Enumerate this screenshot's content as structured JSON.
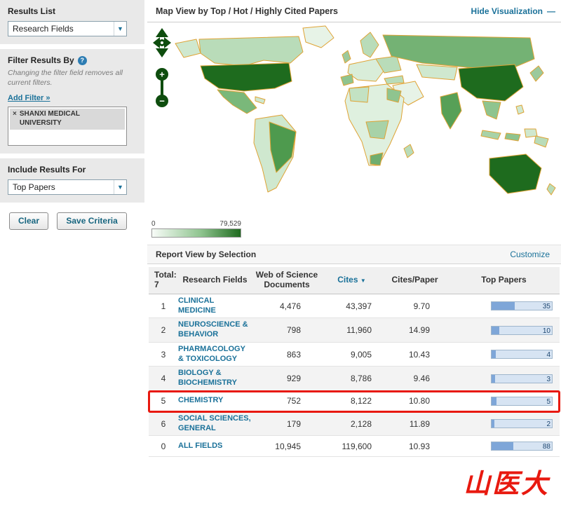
{
  "icons": {
    "dropdown_arrow": "▼",
    "sort_desc": "▼",
    "help": "?",
    "minimize": "—",
    "remove": "×",
    "zoom_in": "+",
    "zoom_out": "−"
  },
  "sidebar": {
    "results_list": {
      "label": "Results List",
      "dropdown_value": "Research Fields"
    },
    "filter": {
      "label": "Filter Results By",
      "note": "Changing the filter field removes all current filters.",
      "add_filter_label": "Add Filter »",
      "selected_filter": "SHANXI MEDICAL UNIVERSITY"
    },
    "include": {
      "label": "Include Results For",
      "dropdown_value": "Top Papers"
    },
    "buttons": {
      "clear": "Clear",
      "save": "Save Criteria"
    }
  },
  "header": {
    "title": "Map View by  Top / Hot / Highly Cited Papers",
    "hide_link": "Hide Visualization"
  },
  "map": {
    "legend_min": "0",
    "legend_max": "79,529",
    "min_color": "#f8fcf8",
    "max_color": "#1f6b1f",
    "border_color": "#dfa335"
  },
  "report": {
    "title": "Report View by Selection",
    "customize": "Customize"
  },
  "table": {
    "total_label": "Total:",
    "total_value": "7",
    "columns": {
      "field": "Research Fields",
      "docs": "Web of Science Documents",
      "cites": "Cites",
      "cpp": "Cites/Paper",
      "top": "Top Papers"
    },
    "rows": [
      {
        "rank": "1",
        "field": "CLINICAL MEDICINE",
        "docs": "4,476",
        "cites": "43,397",
        "cpp": "9.70",
        "top": "35",
        "bar_pct": 38,
        "highlight": false
      },
      {
        "rank": "2",
        "field": "NEUROSCIENCE & BEHAVIOR",
        "docs": "798",
        "cites": "11,960",
        "cpp": "14.99",
        "top": "10",
        "bar_pct": 13,
        "highlight": false
      },
      {
        "rank": "3",
        "field": "PHARMACOLOGY & TOXICOLOGY",
        "docs": "863",
        "cites": "9,005",
        "cpp": "10.43",
        "top": "4",
        "bar_pct": 7,
        "highlight": false
      },
      {
        "rank": "4",
        "field": "BIOLOGY & BIOCHEMISTRY",
        "docs": "929",
        "cites": "8,786",
        "cpp": "9.46",
        "top": "3",
        "bar_pct": 6,
        "highlight": false
      },
      {
        "rank": "5",
        "field": "CHEMISTRY",
        "docs": "752",
        "cites": "8,122",
        "cpp": "10.80",
        "top": "5",
        "bar_pct": 8,
        "highlight": true
      },
      {
        "rank": "6",
        "field": "SOCIAL SCIENCES, GENERAL",
        "docs": "179",
        "cites": "2,128",
        "cpp": "11.89",
        "top": "2",
        "bar_pct": 5,
        "highlight": false
      },
      {
        "rank": "0",
        "field": "ALL FIELDS",
        "docs": "10,945",
        "cites": "119,600",
        "cpp": "10.93",
        "top": "88",
        "bar_pct": 36,
        "highlight": false
      }
    ]
  },
  "watermark": "山医大"
}
